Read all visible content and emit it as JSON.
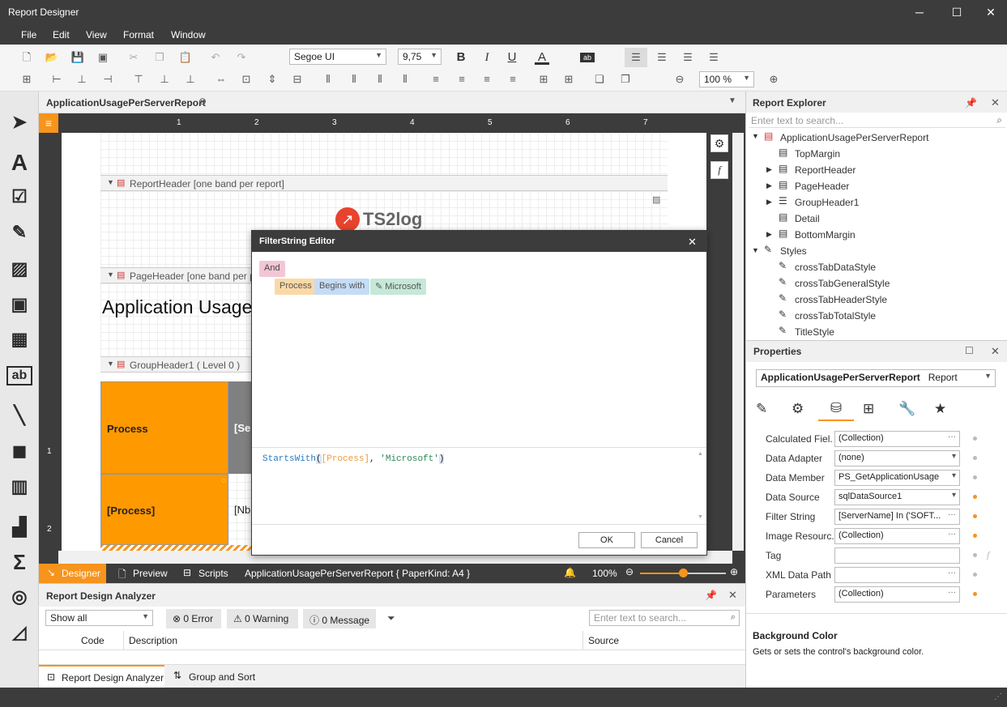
{
  "window": {
    "title": "Report Designer",
    "min": "─",
    "max": "☐",
    "close": "✕"
  },
  "menu": [
    "File",
    "Edit",
    "View",
    "Format",
    "Window"
  ],
  "toolbar": {
    "font": "Segoe UI",
    "size": "9,75",
    "zoom": "100 %",
    "bold": "B",
    "italic": "I",
    "underline": "U",
    "fontcolor": "A",
    "backcolor": "ab"
  },
  "doc_tab": "ApplicationUsagePerServerReport",
  "ruler": [
    "1",
    "2",
    "3",
    "4",
    "5",
    "6",
    "7"
  ],
  "vruler": [
    "1",
    "2"
  ],
  "report": {
    "report_header": "ReportHeader [one band per report]",
    "page_header": "PageHeader [one band per pag",
    "group_header": "GroupHeader1 ( Level 0 )",
    "logo_text": "TS2log",
    "title": "Application Usage",
    "col_process": "Process",
    "col_server": "[Ser",
    "cell_process": "[Process]",
    "cell_nb": "[Nb"
  },
  "bottom_tabs": {
    "designer": "Designer",
    "preview": "Preview",
    "scripts": "Scripts",
    "info": "ApplicationUsagePerServerReport { PaperKind: A4 }",
    "zoom": "100%"
  },
  "analyzer": {
    "title": "Report Design Analyzer",
    "filter": "Show all",
    "error": "0 Error",
    "warning": "0 Warning",
    "message": "0 Message",
    "search_placeholder": "Enter text to search...",
    "columns": [
      "Code",
      "Description",
      "Source"
    ],
    "tab1": "Report Design Analyzer",
    "tab2": "Group and Sort"
  },
  "explorer": {
    "title": "Report Explorer",
    "search_placeholder": "Enter text to search...",
    "root": "ApplicationUsagePerServerReport",
    "items": [
      "TopMargin",
      "ReportHeader",
      "PageHeader",
      "GroupHeader1",
      "Detail",
      "BottomMargin"
    ],
    "styles_label": "Styles",
    "styles": [
      "crossTabDataStyle",
      "crossTabGeneralStyle",
      "crossTabHeaderStyle",
      "crossTabTotalStyle",
      "TitleStyle"
    ]
  },
  "properties": {
    "title": "Properties",
    "selector": "ApplicationUsagePerServerReport",
    "selector_type": "Report",
    "rows": [
      {
        "name": "Calculated Fiel...",
        "value": "(Collection)",
        "btn": "···"
      },
      {
        "name": "Data Adapter",
        "value": "(none)",
        "btn": "▾"
      },
      {
        "name": "Data Member",
        "value": "PS_GetApplicationUsage",
        "btn": "▾"
      },
      {
        "name": "Data Source",
        "value": "sqlDataSource1",
        "btn": "▾"
      },
      {
        "name": "Filter String",
        "value": "[ServerName] In ('SOFT...",
        "btn": "···"
      },
      {
        "name": "Image Resourc...",
        "value": "(Collection)",
        "btn": "···"
      },
      {
        "name": "Tag",
        "value": "",
        "btn": ""
      },
      {
        "name": "XML Data Path",
        "value": "",
        "btn": "···"
      },
      {
        "name": "Parameters",
        "value": "(Collection)",
        "btn": "···"
      }
    ],
    "desc_title": "Background Color",
    "desc_text": "Gets or sets the control's background color."
  },
  "dialog": {
    "title": "FilterString Editor",
    "and": "And",
    "field": "Process",
    "op": "Begins with",
    "value": "Microsoft",
    "expr_fn": "StartsWith",
    "expr_open": "(",
    "expr_field": "[Process]",
    "expr_sep": ", ",
    "expr_value": "'Microsoft'",
    "expr_close": ")",
    "ok": "OK",
    "cancel": "Cancel"
  },
  "colors": {
    "accent": "#f7941d",
    "dark": "#3c3c3c",
    "orange_cell": "#ff9900"
  }
}
